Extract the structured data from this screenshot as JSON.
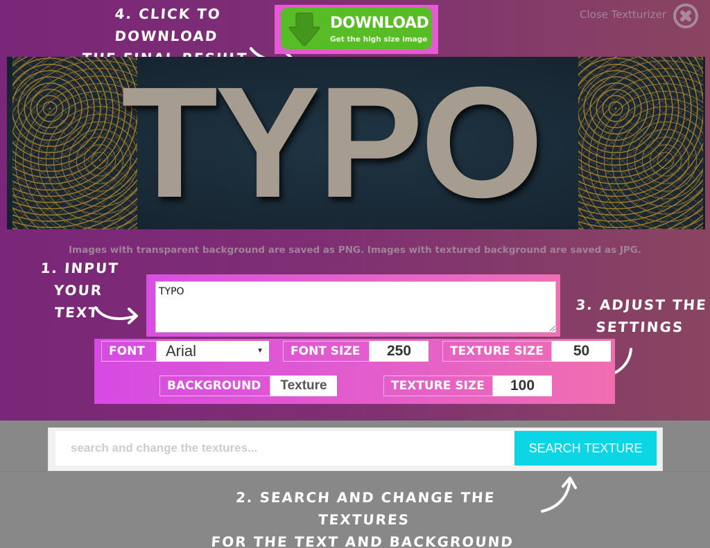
{
  "annotations": {
    "step4": [
      "4. Click to download",
      "the final result"
    ],
    "step1": [
      "1. Input your",
      "text"
    ],
    "step3": [
      "3. Adjust the",
      "settings"
    ],
    "step2": [
      "2. Search and change the textures",
      "for the text and background"
    ]
  },
  "download": {
    "title": "DOWNLOAD",
    "subtitle": "Get the high size image",
    "icon": "download-arrow-icon"
  },
  "close": {
    "label": "Close Textturizer",
    "icon": "close-circle-icon"
  },
  "preview": {
    "text": "TYPO"
  },
  "info_note": "Images with transparent background are saved as PNG. Images with textured background are saved as JPG.",
  "text_input": {
    "value": "TYPO"
  },
  "settings": {
    "font": {
      "label": "FONT",
      "value": "Arial"
    },
    "font_size": {
      "label": "FONT SIZE",
      "value": "250"
    },
    "texture_size_text": {
      "label": "TEXTURE SIZE",
      "value": "50"
    },
    "background": {
      "label": "BACKGROUND",
      "value": "Texture"
    },
    "texture_size_bg": {
      "label": "TEXTURE SIZE",
      "value": "100"
    }
  },
  "search": {
    "placeholder": "search and change the textures...",
    "value": "",
    "button_label": "SEARCH TEXTURE"
  },
  "colors": {
    "accent_pink": "#e35ad3",
    "download_green": "#58bc26",
    "search_cyan": "#0cd6e6",
    "panel_purple": "#7a2679"
  }
}
